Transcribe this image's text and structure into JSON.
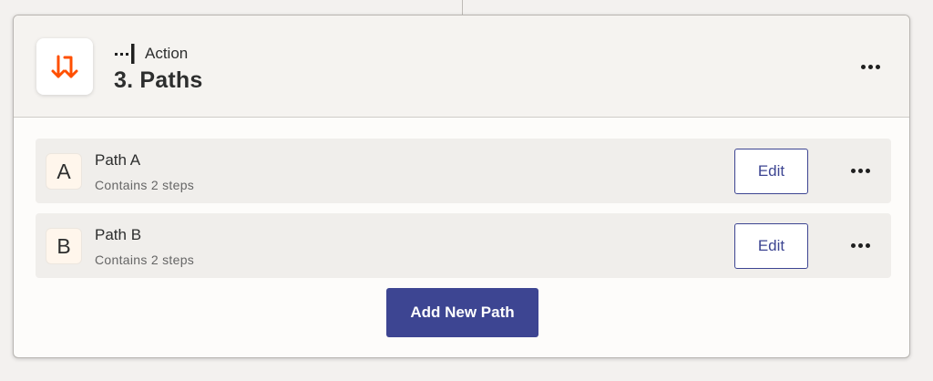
{
  "step": {
    "kind_label": "Action",
    "title": "3. Paths",
    "app_icon": "paths-split-icon",
    "kind_icon": "action-step-icon",
    "accent_color": "#ff4f00"
  },
  "paths": [
    {
      "letter": "A",
      "name": "Path A",
      "subtitle": "Contains 2 steps",
      "edit_label": "Edit"
    },
    {
      "letter": "B",
      "name": "Path B",
      "subtitle": "Contains 2 steps",
      "edit_label": "Edit"
    }
  ],
  "add_button_label": "Add New Path",
  "colors": {
    "primary": "#3d4592",
    "card_bg": "#fdfcfa",
    "header_bg": "#f5f3f0",
    "row_bg": "#f0eeeb",
    "text": "#2d2e2e"
  }
}
